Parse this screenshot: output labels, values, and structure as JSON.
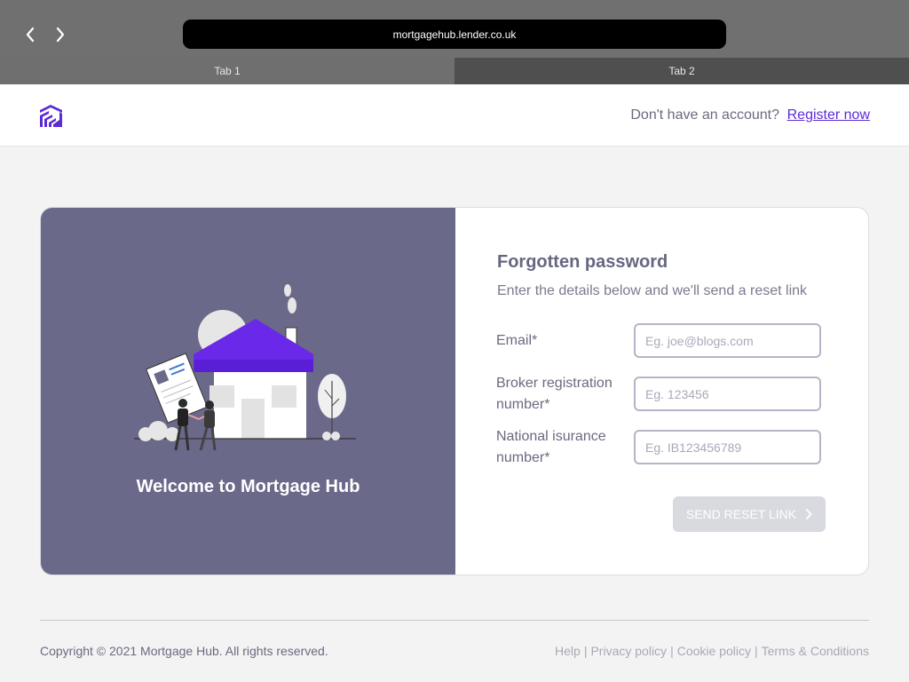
{
  "browser": {
    "url": "mortgagehub.lender.co.uk",
    "tabs": [
      {
        "label": "Tab 1"
      },
      {
        "label": "Tab 2"
      }
    ]
  },
  "header": {
    "question": "Don't have an account?",
    "register_label": "Register now"
  },
  "welcome": {
    "title": "Welcome to Mortgage Hub"
  },
  "form": {
    "title": "Forgotten password",
    "subtitle": "Enter the details below and we'll send a reset link",
    "fields": [
      {
        "label": "Email*",
        "placeholder": "Eg. joe@blogs.com",
        "value": ""
      },
      {
        "label": "Broker registration number*",
        "placeholder": "Eg. 123456",
        "value": ""
      },
      {
        "label": "National isurance number*",
        "placeholder": "Eg. IB123456789",
        "value": ""
      }
    ],
    "submit_label": "SEND RESET LINK"
  },
  "footer": {
    "copyright": "Copyright © 2021 Mortgage Hub. All rights reserved.",
    "links": [
      {
        "label": "Help"
      },
      {
        "label": "Privacy policy"
      },
      {
        "label": "Cookie policy"
      },
      {
        "label": "Terms & Conditions"
      }
    ],
    "separator": "|"
  },
  "colors": {
    "accent": "#5b2bd6",
    "panel": "#6b6989",
    "button_disabled": "#d9d9e0"
  },
  "icons": {
    "back": "chevron-left-icon",
    "forward": "chevron-right-icon",
    "logo": "mortgage-hub-logo",
    "send": "chevron-right-icon"
  }
}
